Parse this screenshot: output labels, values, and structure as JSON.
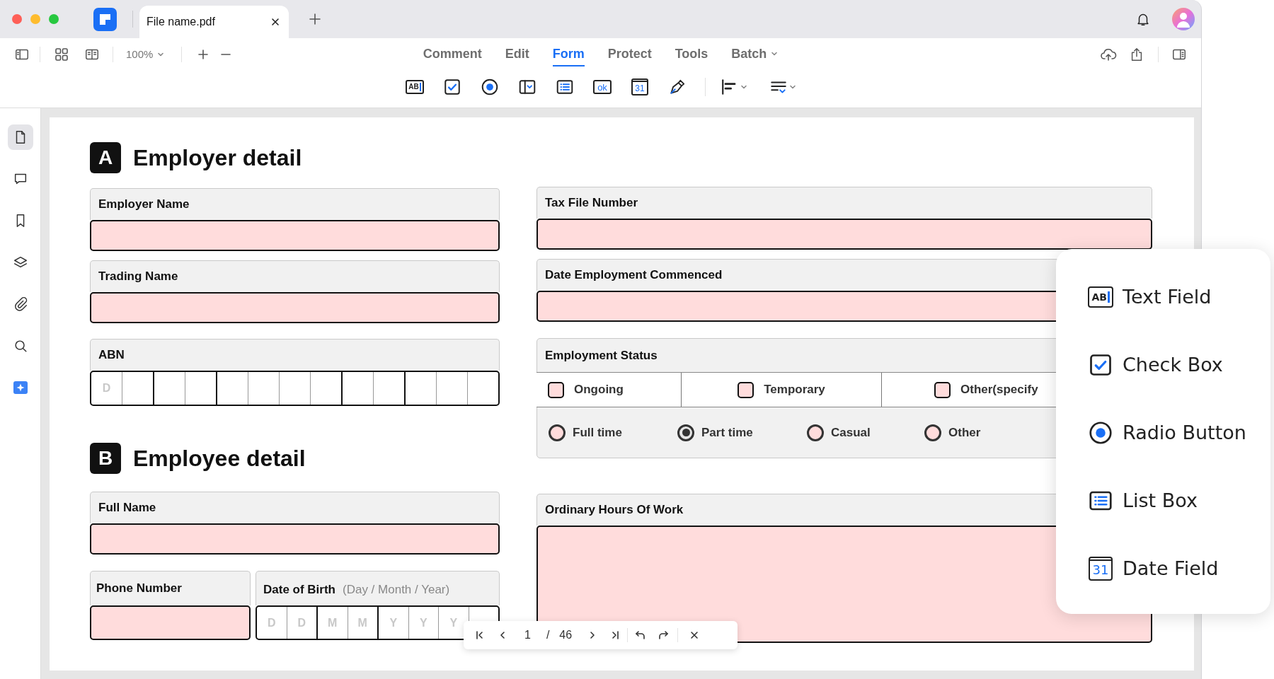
{
  "tab": {
    "title": "File name.pdf"
  },
  "toolbar": {
    "zoom": "100%",
    "menu": [
      {
        "label": "Comment",
        "selected": false,
        "dropdown": false
      },
      {
        "label": "Edit",
        "selected": false,
        "dropdown": false
      },
      {
        "label": "Form",
        "selected": true,
        "dropdown": false
      },
      {
        "label": "Protect",
        "selected": false,
        "dropdown": false
      },
      {
        "label": "Tools",
        "selected": false,
        "dropdown": false
      },
      {
        "label": "Batch",
        "selected": false,
        "dropdown": true
      }
    ]
  },
  "form_tools": [
    {
      "kind": "text",
      "glyph": "AB"
    },
    {
      "kind": "checkbox"
    },
    {
      "kind": "radio"
    },
    {
      "kind": "dropdown"
    },
    {
      "kind": "list"
    },
    {
      "kind": "button",
      "glyph": "ok"
    },
    {
      "kind": "date",
      "glyph": "31"
    },
    {
      "kind": "signature"
    }
  ],
  "sidebar": [
    {
      "kind": "page",
      "selected": true
    },
    {
      "kind": "comment",
      "selected": false
    },
    {
      "kind": "bookmark",
      "selected": false
    },
    {
      "kind": "layers",
      "selected": false
    },
    {
      "kind": "attachment",
      "selected": false
    },
    {
      "kind": "search",
      "selected": false
    },
    {
      "kind": "ai",
      "selected": false
    }
  ],
  "sections": [
    {
      "letter": "A",
      "title": "Employer detail"
    },
    {
      "letter": "B",
      "title": "Employee detail"
    }
  ],
  "employer_name": {
    "label": "Employer Name"
  },
  "trading_name": {
    "label": "Trading Name"
  },
  "abn": {
    "label": "ABN",
    "placeholder": "D"
  },
  "tax_file_number": {
    "label": "Tax File Number"
  },
  "date_employment_commenced": {
    "label": "Date Employment Commenced"
  },
  "employment_status": {
    "label": "Employment Status",
    "checkboxes": [
      {
        "label": "Ongoing",
        "checked": false
      },
      {
        "label": "Temporary",
        "checked": false
      },
      {
        "label": "Other(specify",
        "checked": false
      }
    ],
    "radios": [
      {
        "label": "Full time",
        "selected": false
      },
      {
        "label": "Part time",
        "selected": true
      },
      {
        "label": "Casual",
        "selected": false
      },
      {
        "label": "Other",
        "selected": false
      }
    ]
  },
  "full_name": {
    "label": "Full Name"
  },
  "phone_number": {
    "label": "Phone Number"
  },
  "date_of_birth": {
    "label": "Date of Birth",
    "hint": "(Day / Month / Year)",
    "placeholders": [
      "D",
      "D",
      "M",
      "M",
      "Y",
      "Y",
      "Y"
    ]
  },
  "ordinary_hours": {
    "label": "Ordinary Hours Of Work"
  },
  "pager": {
    "page": "1",
    "separator": "/",
    "total": "46"
  },
  "field_menu": [
    {
      "kind": "text",
      "label": "Text Field",
      "glyph": "AB"
    },
    {
      "kind": "checkbox",
      "label": "Check Box"
    },
    {
      "kind": "radio",
      "label": "Radio Button"
    },
    {
      "kind": "list",
      "label": "List Box"
    },
    {
      "kind": "date",
      "label": "Date Field",
      "glyph": "31"
    }
  ]
}
